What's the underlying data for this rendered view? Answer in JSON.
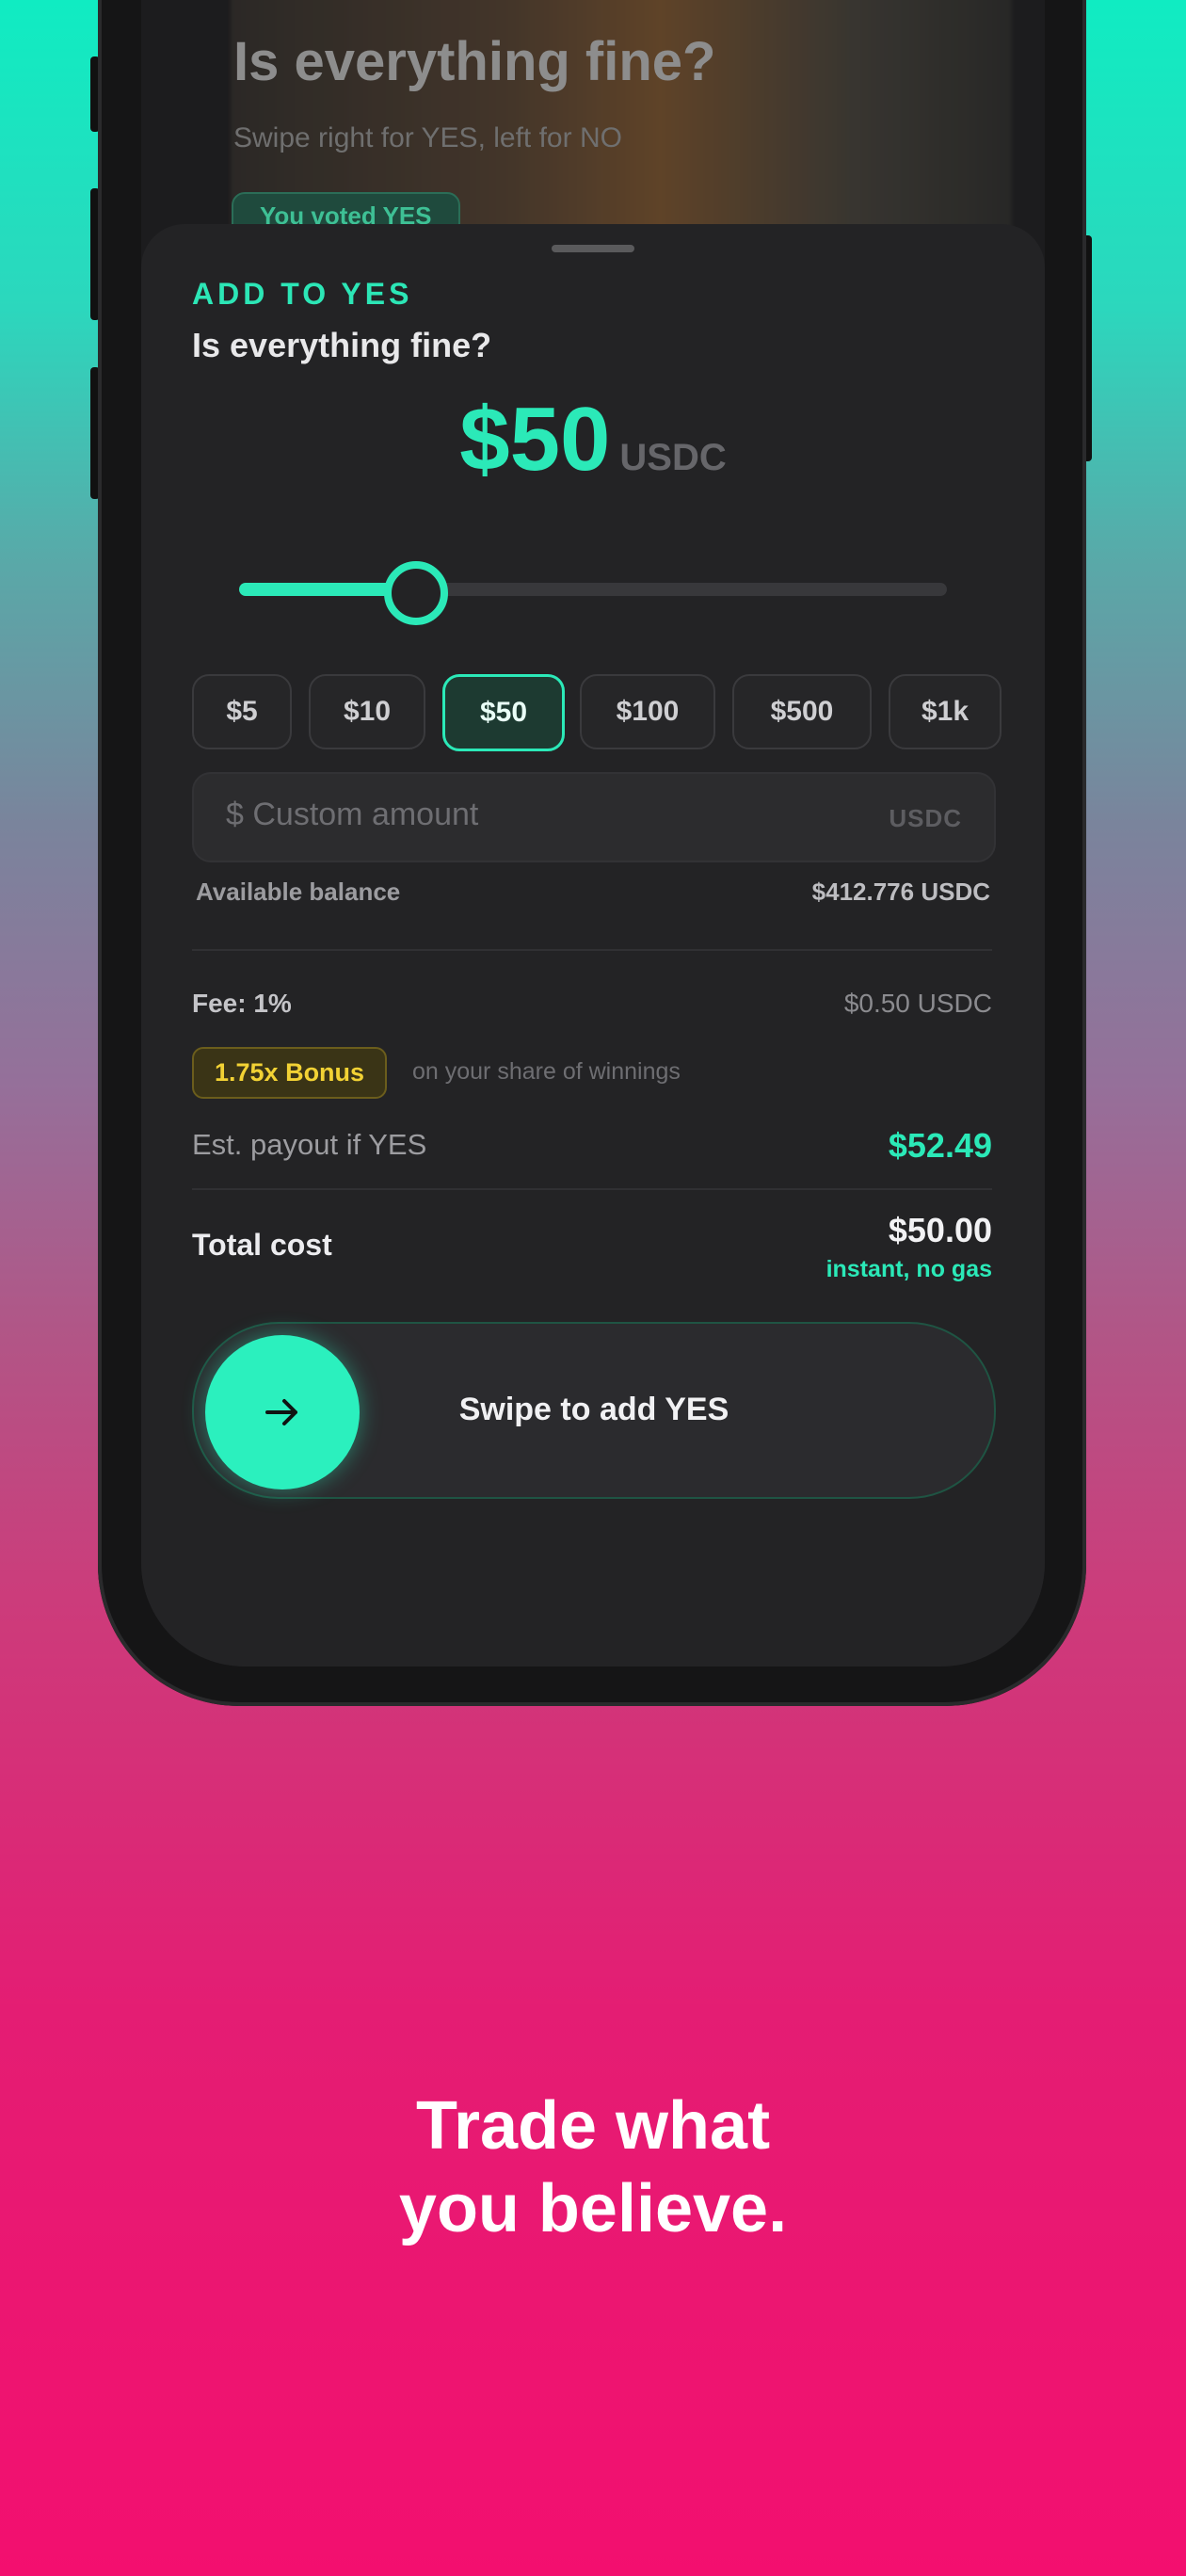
{
  "background_card": {
    "title": "Is everything fine?",
    "subtitle": "Swipe right for YES, left for NO",
    "vote_pill": "You voted YES"
  },
  "sheet": {
    "eyebrow": "ADD TO YES",
    "question": "Is everything fine?",
    "amount": "$50",
    "amount_unit": "USDC",
    "slider_fraction": 0.25,
    "chips": [
      {
        "label": "$5",
        "selected": false
      },
      {
        "label": "$10",
        "selected": false
      },
      {
        "label": "$50",
        "selected": true
      },
      {
        "label": "$100",
        "selected": false
      },
      {
        "label": "$500",
        "selected": false
      },
      {
        "label": "$1k",
        "selected": false
      }
    ],
    "custom_placeholder": "$ Custom amount",
    "custom_unit": "USDC",
    "available_label": "Available balance",
    "available_value": "$412.776 USDC",
    "fee_label": "Fee: 1%",
    "fee_value": "$0.50 USDC",
    "bonus_badge": "1.75x Bonus",
    "bonus_note": "on your share of winnings",
    "payout_label": "Est. payout if YES",
    "payout_value": "$52.49",
    "total_label": "Total cost",
    "total_value": "$50.00",
    "total_sub": "instant, no gas",
    "swipe_label": "Swipe to add YES",
    "swipe_icon": "arrow-right-icon"
  },
  "tagline": {
    "line1": "Trade what",
    "line2": "you believe."
  },
  "colors": {
    "accent": "#2be9b8",
    "bonus": "#f2d234",
    "gradient_top": "#10ecc2",
    "gradient_bottom": "#f30f6f"
  }
}
